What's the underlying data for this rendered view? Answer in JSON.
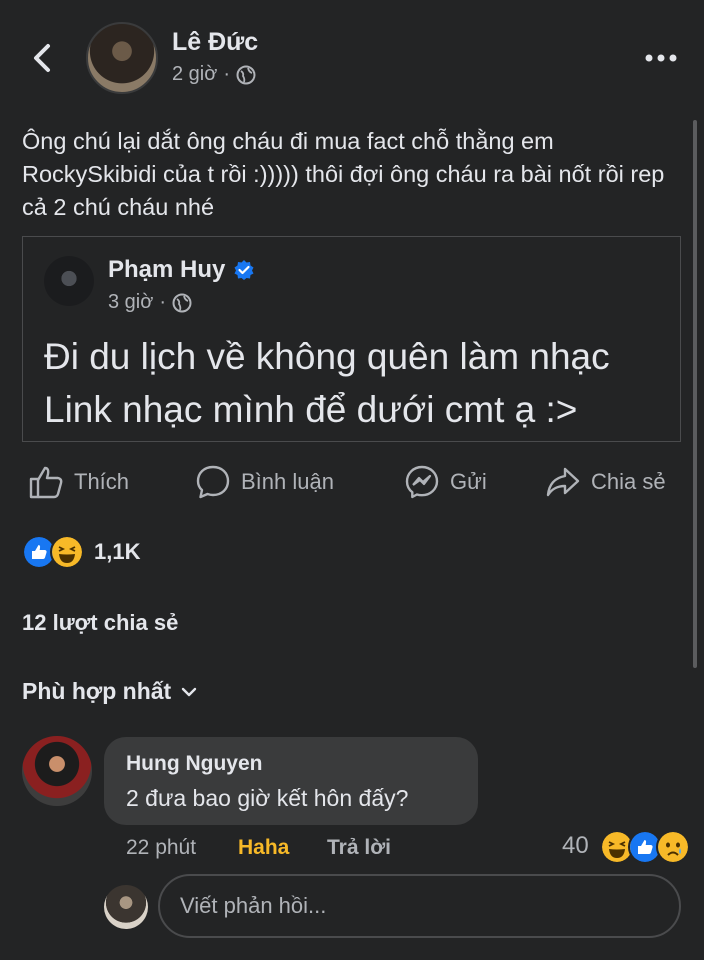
{
  "header": {
    "author": "Lê Đức",
    "time": "2 giờ",
    "separator": "·",
    "privacy_icon": "globe-icon",
    "back_icon": "chevron-left-icon",
    "more_icon": "more-horizontal-icon"
  },
  "post": {
    "text": "Ông chú lại dắt ông cháu đi mua fact chỗ thằng em RockySkibidi của t rồi :))))) thôi đợi ông cháu ra bài nốt rồi rep cả 2 chú cháu nhé"
  },
  "shared": {
    "author": "Phạm Huy",
    "verified_icon": "verified-badge-icon",
    "time": "3 giờ",
    "separator": "·",
    "line1": "Đi du lịch về không quên làm nhạc",
    "line2": "Link nhạc mình để dưới cmt ạ :>"
  },
  "actions": [
    {
      "label": "Thích",
      "icon": "like-icon"
    },
    {
      "label": "Bình luận",
      "icon": "comment-icon"
    },
    {
      "label": "Gửi",
      "icon": "messenger-icon"
    },
    {
      "label": "Chia sẻ",
      "icon": "share-icon"
    }
  ],
  "stats": {
    "reaction_count": "1,1K",
    "shares": "12 lượt chia sẻ"
  },
  "sort": {
    "label": "Phù hợp nhất"
  },
  "comment": {
    "name": "Hung Nguyen",
    "text": "2 đưa bao giờ kết hôn đấy?",
    "time": "22 phút",
    "reaction_label": "Haha",
    "reply_label": "Trả lời",
    "reaction_count": "40"
  },
  "reply_input": {
    "placeholder": "Viết phản hồi..."
  },
  "colors": {
    "background": "#232425",
    "like_blue": "#1877f2",
    "haha_yellow": "#f7b928"
  }
}
